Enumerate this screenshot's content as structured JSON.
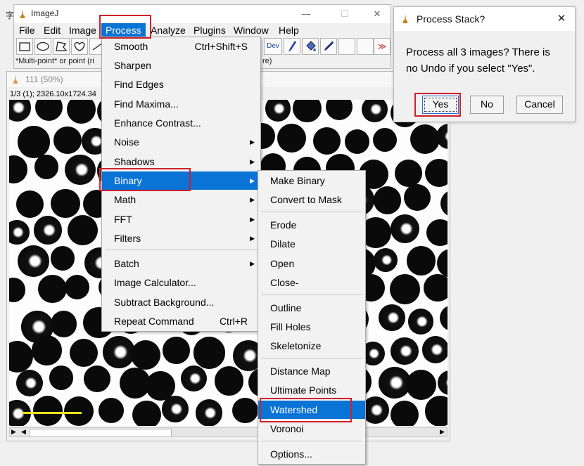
{
  "background_windows": {
    "left_char": "字"
  },
  "imagej": {
    "title": "ImageJ",
    "menubar": [
      "File",
      "Edit",
      "Image",
      "Process",
      "Analyze",
      "Plugins",
      "Window",
      "Help"
    ],
    "toolbar": {
      "dev_label": "Dev",
      "more_label": "≫"
    },
    "status_text": "*Multi-point* or point (ri",
    "status_tail": "re)"
  },
  "image_window": {
    "title": "111 (50%)",
    "info": "1/3 (1); 2326.10x1724.34"
  },
  "process_menu": {
    "items": [
      {
        "label": "Smooth",
        "shortcut": "Ctrl+Shift+S"
      },
      {
        "label": "Sharpen"
      },
      {
        "label": "Find Edges"
      },
      {
        "label": "Find Maxima..."
      },
      {
        "label": "Enhance Contrast..."
      },
      {
        "label": "Noise",
        "submenu": true
      },
      {
        "label": "Shadows",
        "submenu": true
      },
      {
        "label": "Binary",
        "submenu": true,
        "selected": true
      },
      {
        "label": "Math",
        "submenu": true
      },
      {
        "label": "FFT",
        "submenu": true
      },
      {
        "label": "Filters",
        "submenu": true
      },
      {
        "label": "Batch",
        "submenu": true
      },
      {
        "label": "Image Calculator..."
      },
      {
        "label": "Subtract Background..."
      },
      {
        "label": "Repeat Command",
        "shortcut": "Ctrl+R"
      }
    ]
  },
  "binary_menu": {
    "items": [
      {
        "label": "Make Binary"
      },
      {
        "label": "Convert to Mask"
      },
      {
        "label": "Erode"
      },
      {
        "label": "Dilate"
      },
      {
        "label": "Open"
      },
      {
        "label": "Close-"
      },
      {
        "label": "Outline"
      },
      {
        "label": "Fill Holes"
      },
      {
        "label": "Skeletonize"
      },
      {
        "label": "Distance Map"
      },
      {
        "label": "Ultimate Points"
      },
      {
        "label": "Watershed",
        "selected": true
      },
      {
        "label": "Voronoi"
      },
      {
        "label": "Options..."
      }
    ]
  },
  "dialog": {
    "title": "Process Stack?",
    "message_line1": "Process all 3 images? There is",
    "message_line2": "no Undo if you select \"Yes\".",
    "yes": "Yes",
    "no": "No",
    "cancel": "Cancel",
    "close": "✕"
  },
  "colors": {
    "highlight": "#0a73d6",
    "annotation_red": "#d0202a"
  }
}
